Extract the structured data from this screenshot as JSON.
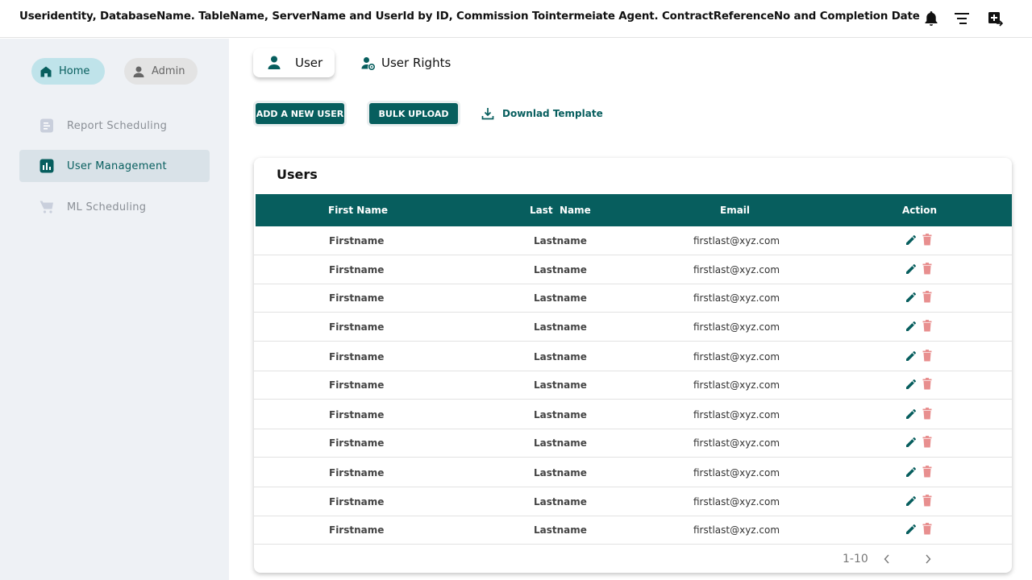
{
  "header": {
    "title": "Useridentity, DatabaseName. TableName, ServerName and UserId by ID, Commission Tointermeiate Agent. ContractReferenceNo and Completion Date"
  },
  "sidebar": {
    "home_label": "Home",
    "admin_label": "Admin",
    "items": [
      {
        "label": "Report Scheduling",
        "icon": "document-icon"
      },
      {
        "label": "User Management",
        "icon": "bar-chart-icon",
        "active": true
      },
      {
        "label": "ML Scheduling",
        "icon": "cart-icon"
      }
    ]
  },
  "tabs": [
    {
      "label": "User",
      "active": true
    },
    {
      "label": "User Rights"
    }
  ],
  "actions": {
    "add_label": "ADD A NEW USER",
    "bulk_label": "BULK UPLOAD",
    "download_label": "Downlad Template"
  },
  "table": {
    "title": "Users",
    "columns": [
      "First Name",
      "Last  Name",
      "Email",
      "Action"
    ],
    "rows": [
      {
        "first": "Firstname",
        "last": "Lastname",
        "email": "firstlast@xyz.com"
      },
      {
        "first": "Firstname",
        "last": "Lastname",
        "email": "firstlast@xyz.com"
      },
      {
        "first": "Firstname",
        "last": "Lastname",
        "email": "firstlast@xyz.com"
      },
      {
        "first": "Firstname",
        "last": "Lastname",
        "email": "firstlast@xyz.com"
      },
      {
        "first": "Firstname",
        "last": "Lastname",
        "email": "firstlast@xyz.com"
      },
      {
        "first": "Firstname",
        "last": "Lastname",
        "email": "firstlast@xyz.com"
      },
      {
        "first": "Firstname",
        "last": "Lastname",
        "email": "firstlast@xyz.com"
      },
      {
        "first": "Firstname",
        "last": "Lastname",
        "email": "firstlast@xyz.com"
      },
      {
        "first": "Firstname",
        "last": "Lastname",
        "email": "firstlast@xyz.com"
      },
      {
        "first": "Firstname",
        "last": "Lastname",
        "email": "firstlast@xyz.com"
      },
      {
        "first": "Firstname",
        "last": "Lastname",
        "email": "firstlast@xyz.com"
      }
    ],
    "pagination": "1-10"
  },
  "colors": {
    "primary": "#075e5e",
    "delete": "#e88f8f",
    "sidebar_bg": "#eef1f5"
  }
}
